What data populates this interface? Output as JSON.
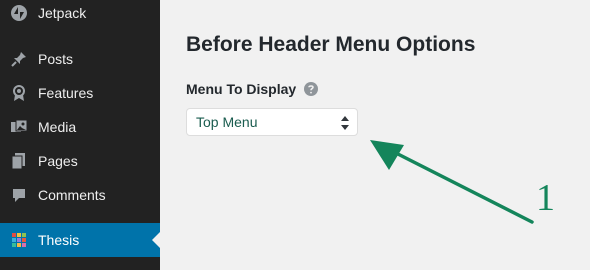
{
  "sidebar": {
    "items": [
      {
        "label": "Jetpack",
        "icon": "jetpack-icon"
      },
      {
        "label": "Posts",
        "icon": "pin-icon"
      },
      {
        "label": "Features",
        "icon": "award-icon"
      },
      {
        "label": "Media",
        "icon": "media-icon"
      },
      {
        "label": "Pages",
        "icon": "pages-icon"
      },
      {
        "label": "Comments",
        "icon": "comment-icon"
      },
      {
        "label": "Thesis",
        "icon": "thesis-icon",
        "active": true
      }
    ]
  },
  "main": {
    "title": "Before Header Menu Options",
    "field_label": "Menu To Display",
    "select_value": "Top Menu"
  },
  "annotation": {
    "number": "1",
    "color": "#14855b"
  },
  "colors": {
    "sidebar_bg": "#222222",
    "active_bg": "#0073aa",
    "content_bg": "#f1f1f1"
  }
}
